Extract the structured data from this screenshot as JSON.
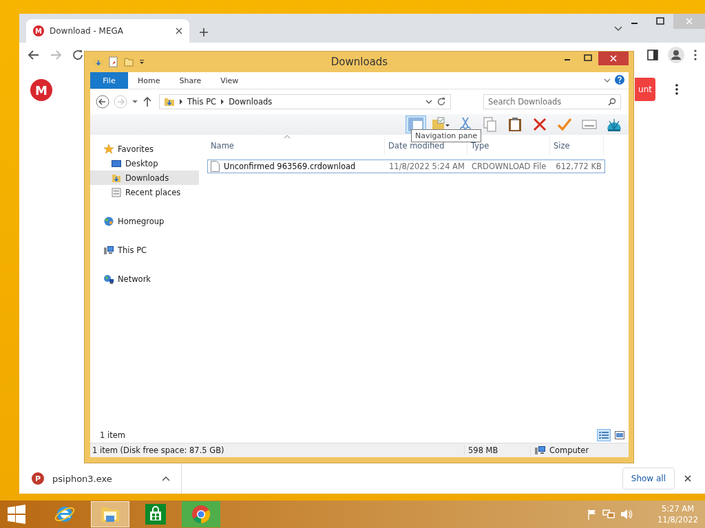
{
  "browser": {
    "tab": {
      "title": "Download - MEGA",
      "icon_letter": "M"
    },
    "page": {
      "logo_letter": "M",
      "button_label": "unt"
    }
  },
  "explorer": {
    "title": "Downloads",
    "file_tab": "File",
    "ribbon_tabs": [
      "Home",
      "Share",
      "View"
    ],
    "breadcrumb": [
      "This PC",
      "Downloads"
    ],
    "search": {
      "placeholder": "Search Downloads"
    },
    "tooltip": "Navigation pane",
    "nav": [
      {
        "label": "Favorites",
        "kind": "star",
        "selected": false,
        "children": [
          {
            "label": "Desktop",
            "kind": "desktop",
            "selected": false
          },
          {
            "label": "Downloads",
            "kind": "downloads",
            "selected": true
          },
          {
            "label": "Recent places",
            "kind": "recent",
            "selected": false
          }
        ]
      },
      {
        "label": "Homegroup",
        "kind": "homegroup",
        "selected": false
      },
      {
        "label": "This PC",
        "kind": "pc",
        "selected": false
      },
      {
        "label": "Network",
        "kind": "network",
        "selected": false
      }
    ],
    "columns": [
      "Name",
      "Date modified",
      "Type",
      "Size"
    ],
    "files": [
      {
        "name": "Unconfirmed 963569.crdownload",
        "date": "11/8/2022 5:24 AM",
        "type": "CRDOWNLOAD File",
        "size": "612,772 KB",
        "selected": true
      }
    ],
    "item_count": "1 item",
    "view_buttons": [
      {
        "kind": "details",
        "selected": true
      },
      {
        "kind": "large-icons",
        "selected": false
      }
    ],
    "status": {
      "text": "1 item (Disk free space: 87.5 GB)",
      "size": "598 MB",
      "location": "Computer"
    }
  },
  "download_bar": {
    "icon_letter": "P",
    "file": "psiphon3.exe",
    "button": "Show all"
  },
  "taskbar": {
    "apps": [
      {
        "kind": "ie",
        "selected": false
      },
      {
        "kind": "explorer",
        "selected": true
      },
      {
        "kind": "store",
        "selected": false
      },
      {
        "kind": "chrome",
        "selected": false
      }
    ]
  },
  "clock": {
    "time": "5:27 AM",
    "date": "11/8/2022"
  }
}
